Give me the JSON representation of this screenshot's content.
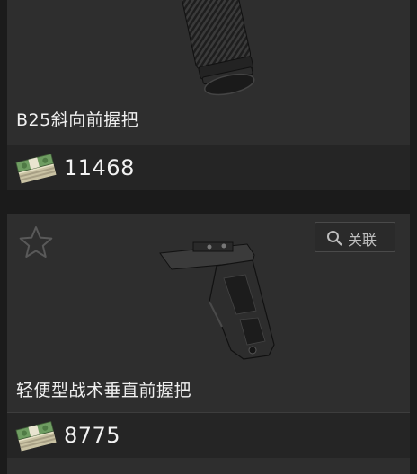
{
  "items": [
    {
      "name": "B25斜向前握把",
      "price": "11468",
      "image_icon": "grip-icon",
      "currency_icon": "money-stack-icon"
    },
    {
      "name": "轻便型战术垂直前握把",
      "price": "8775",
      "image_icon": "vertical-grip-icon",
      "currency_icon": "money-stack-icon",
      "favorite_icon": "star-outline-icon",
      "link_button": {
        "label": "关联",
        "icon": "search-icon"
      }
    }
  ],
  "colors": {
    "background": "#1b1b1b",
    "card": "#2e2e2e",
    "price_row": "#252525",
    "text": "#f0f0f0",
    "cash_green": "#5e8a55"
  }
}
